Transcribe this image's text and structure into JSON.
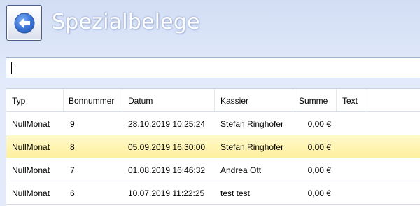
{
  "window": {
    "title": "Spezialbelege"
  },
  "header": {
    "back_icon": "arrow-left-circle-icon"
  },
  "search": {
    "value": "",
    "placeholder": ""
  },
  "table": {
    "columns": [
      "Typ",
      "Bonnummer",
      "Datum",
      "Kassier",
      "Summe",
      "Text"
    ],
    "rows": [
      {
        "typ": "NullMonat",
        "bonnummer": "9",
        "datum": "28.10.2019 10:25:24",
        "kassier": "Stefan Ringhofer",
        "summe": "0,00 €",
        "text": "",
        "selected": false
      },
      {
        "typ": "NullMonat",
        "bonnummer": "8",
        "datum": "05.09.2019 16:30:00",
        "kassier": "Stefan Ringhofer",
        "summe": "0,00 €",
        "text": "",
        "selected": true
      },
      {
        "typ": "NullMonat",
        "bonnummer": "7",
        "datum": "01.08.2019 16:46:32",
        "kassier": "Andrea Ott",
        "summe": "0,00 €",
        "text": "",
        "selected": false
      },
      {
        "typ": "NullMonat",
        "bonnummer": "6",
        "datum": "10.07.2019 11:22:25",
        "kassier": "test test",
        "summe": "0,00 €",
        "text": "",
        "selected": false
      }
    ]
  },
  "colors": {
    "background": "#dbe5f8",
    "accent": "#4a7fd6",
    "selected_row": "#fff5b4"
  }
}
